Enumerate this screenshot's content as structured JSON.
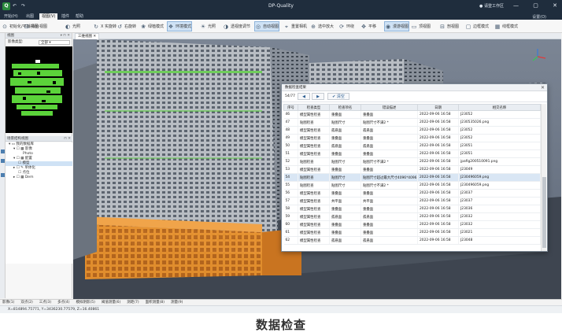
{
  "window": {
    "title": "DP-Quality",
    "user": "请登工作区",
    "quick_access": [
      "↶",
      "↷"
    ],
    "controls": [
      "—",
      "▢",
      "✕"
    ]
  },
  "ribbon": {
    "tabs": [
      "开始(H)",
      "出图",
      "视图(V)",
      "插件",
      "帮助"
    ],
    "active_tab": 2,
    "settings": "设置(O)"
  },
  "toolbar": {
    "items": [
      {
        "label": "初始化/平铺视图",
        "icon": "reset-view-icon"
      },
      {
        "label": "拟合视图",
        "icon": "fit-view-icon"
      },
      {
        "label": "光照",
        "icon": "light-icon"
      },
      {
        "label": "X 实旋转",
        "icon": "rotate-icon"
      },
      {
        "label": "右旋转",
        "icon": "rotate-right-icon"
      },
      {
        "label": "绿植模式",
        "icon": "plant-icon"
      },
      {
        "label": "环境模式",
        "icon": "env-icon",
        "selected": true
      },
      {
        "label": "光照",
        "icon": "sun-icon"
      },
      {
        "label": "透视度调节",
        "icon": "perspective-icon"
      },
      {
        "label": "自动视图",
        "icon": "auto-view-icon",
        "selected": true
      },
      {
        "label": "重置相机",
        "icon": "camera-icon"
      },
      {
        "label": "选中放大",
        "icon": "zoom-icon"
      },
      {
        "label": "环绕",
        "icon": "orbit-icon"
      },
      {
        "label": "平移",
        "icon": "pan-icon"
      },
      {
        "label": "漫游视图",
        "icon": "walk-icon",
        "selected": true
      },
      {
        "label": "顶视图",
        "icon": "top-view-icon"
      },
      {
        "label": "剖视图",
        "icon": "section-icon"
      },
      {
        "label": "边框模式",
        "icon": "frame-icon"
      },
      {
        "label": "线框模式",
        "icon": "wire-icon"
      }
    ]
  },
  "left_panel": {
    "minimap_title": "视图",
    "minimap_filter_label": "影像类型:",
    "minimap_filter_value": "全部",
    "tree_title": "场景结构视图",
    "tree_rows": [
      "我的数据库",
      "影像",
      "Photo",
      "配置",
      "模型",
      "单体化",
      "点位",
      "Dem"
    ]
  },
  "viewport": {
    "tab_label": "三维视图 ✕"
  },
  "dialog": {
    "title": "数据检查结果",
    "counter": "54/77",
    "btn_prev": "◀",
    "btn_next": "▶",
    "btn_clear": "✔ 清空",
    "columns": [
      "序号",
      "检查类型",
      "检查项名",
      "错误描述",
      "日期",
      "相交名称"
    ],
    "rows": [
      [
        "46",
        "模型属性检查",
        "重叠面",
        "重叠面",
        "2022-09-06 16:58",
        "J23052"
      ],
      [
        "47",
        "贴图检查",
        "贴图尺寸",
        "贴图尺寸不满2 *",
        "2022-09-06 16:58",
        "J230535026.png"
      ],
      [
        "48",
        "模型属性检查",
        "孤悬面",
        "孤悬面",
        "2022-09-06 16:58",
        "J23052"
      ],
      [
        "49",
        "模型属性检查",
        "重叠面",
        "重叠面",
        "2022-09-06 16:58",
        "J23052"
      ],
      [
        "50",
        "模型属性检查",
        "孤悬面",
        "孤悬面",
        "2022-09-06 16:58",
        "J23051"
      ],
      [
        "51",
        "模型属性检查",
        "重叠面",
        "重叠面",
        "2022-09-06 16:58",
        "J23051"
      ],
      [
        "52",
        "贴图检查",
        "贴图尺寸",
        "贴图尺寸不满2 *",
        "2022-09-06 16:58",
        "jpafig200510091.png"
      ],
      [
        "53",
        "模型属性检查",
        "重叠面",
        "重叠面",
        "2022-09-06 16:58",
        "J23049"
      ],
      [
        "54",
        "贴图检查",
        "贴图尺寸",
        "贴图尺寸超过最大尺寸4096*4096",
        "2022-09-06 16:58",
        "J230496059.png"
      ],
      [
        "55",
        "贴图检查",
        "贴图尺寸",
        "贴图尺寸不满2 *",
        "2022-09-06 16:58",
        "J230496059.png"
      ],
      [
        "56",
        "模型属性检查",
        "重叠面",
        "重叠面",
        "2022-09-06 16:58",
        "J23037"
      ],
      [
        "57",
        "模型属性检查",
        "共平面",
        "共平面",
        "2022-09-06 16:58",
        "J23037"
      ],
      [
        "58",
        "模型属性检查",
        "重叠面",
        "重叠面",
        "2022-09-06 16:58",
        "J23036"
      ],
      [
        "59",
        "模型属性检查",
        "孤悬面",
        "孤悬面",
        "2022-09-06 16:58",
        "J23032"
      ],
      [
        "60",
        "模型属性检查",
        "重叠面",
        "重叠面",
        "2022-09-06 16:58",
        "J23032"
      ],
      [
        "61",
        "模型属性检查",
        "重叠面",
        "重叠面",
        "2022-09-06 16:58",
        "J23021"
      ],
      [
        "62",
        "模型属性检查",
        "孤悬面",
        "孤悬面",
        "2022-09-06 16:58",
        "J23048"
      ]
    ],
    "highlight_row": 8
  },
  "statusbar": {
    "items": [
      "影像(1)",
      "双点(2)",
      "三点(3)",
      "多点(4)",
      "模拟阴影(5)",
      "阈值测量(6)",
      "测距(7)",
      "面积测量(8)",
      "测量(9)"
    ],
    "coords": "X=814894.75771, Y=3436230.77579, Z=16.40861"
  },
  "caption": "数据检查",
  "colors": {
    "titlebar": "#1f2d3d",
    "selection": "#cfe2f5",
    "orange_highlight": "#e8912b",
    "minimap_green": "#5bd33a"
  }
}
